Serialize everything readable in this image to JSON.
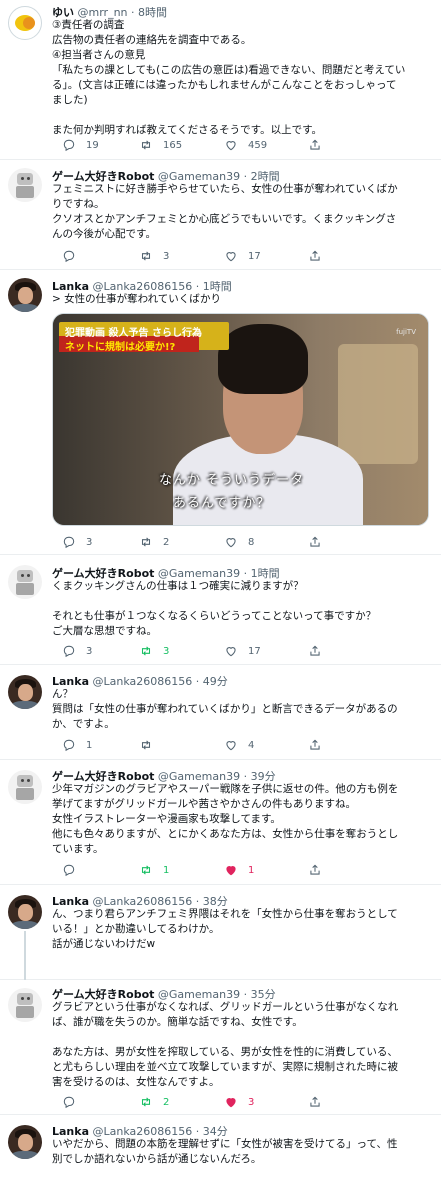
{
  "tweets": [
    {
      "name": "ゆい",
      "handle": "@mrr_nn",
      "time": "· 8時間",
      "lines": [
        "③責任者の調査",
        "広告物の責任者の連絡先を調査中である。",
        "④担当者さんの意見",
        "「私たちの課としても(この広告の意匠は)看過できない、問題だと考えてい",
        "る」。(文言は正確には違ったかもしれませんがこんなことをおっしゃって",
        "ました)",
        "",
        "また何か判明すれば教えてくださるそうです。以上です。"
      ],
      "replies": "19",
      "retweets": "165",
      "likes": "459"
    },
    {
      "name": "ゲーム大好きRobot",
      "handle": "@Gameman39",
      "time": "· 2時間",
      "lines": [
        "フェミニストに好き勝手やらせていたら、女性の仕事が奪われていくばか",
        "りですね。",
        "クソオスとかアンチフェミとか心底どうでもいいです。くまクッキングさ",
        "んの今後が心配です。"
      ],
      "replies": "",
      "retweets": "3",
      "likes": "17"
    },
    {
      "name": "Lanka",
      "handle": "@Lanka26086156",
      "time": "· 1時間",
      "lines": [
        "> 女性の仕事が奪われていくばかり"
      ],
      "media": {
        "banner_top": "犯罪動画 殺人予告 さらし行為",
        "banner_bottom": "ネットに規制は必要か!?",
        "subtitle_1": "なんか そういうデータ",
        "subtitle_2": "あるんですか？",
        "watermark": "fujiTV"
      },
      "replies": "3",
      "retweets": "2",
      "likes": "8"
    },
    {
      "name": "ゲーム大好きRobot",
      "handle": "@Gameman39",
      "time": "· 1時間",
      "lines": [
        "くまクッキングさんの仕事は１つ確実に減りますが？",
        "",
        "それとも仕事が１つなくなるくらいどうってことないって事ですか？",
        "ご大層な思想ですね。"
      ],
      "replies": "3",
      "retweets": "3",
      "likes": "17"
    },
    {
      "name": "Lanka",
      "handle": "@Lanka26086156",
      "time": "· 49分",
      "lines": [
        "ん？",
        "質問は「女性の仕事が奪われていくばかり」と断言できるデータがあるの",
        "か、ですよ。"
      ],
      "replies": "1",
      "retweets": "",
      "likes": "4"
    },
    {
      "name": "ゲーム大好きRobot",
      "handle": "@Gameman39",
      "time": "· 39分",
      "lines": [
        "少年マガジンのグラビアやスーパー戦隊を子供に返せの件。他の方も例を",
        "挙げてますがグリッドガールや茜さやかさんの件もありますね。",
        "女性イラストレーターや漫画家も攻撃してます。",
        "他にも色々ありますが、とにかくあなた方は、女性から仕事を奪おうとし",
        "ています。"
      ],
      "replies": "",
      "retweets": "1",
      "likes": "1"
    },
    {
      "name": "Lanka",
      "handle": "@Lanka26086156",
      "time": "· 38分",
      "lines": [
        "ん、つまり君らアンチフェミ界隈はそれを「女性から仕事を奪おうとして",
        "いる！」とか勘違いしてるわけか。",
        "話が通じないわけだw"
      ],
      "replies": "",
      "retweets": "",
      "likes": ""
    },
    {
      "name": "ゲーム大好きRobot",
      "handle": "@Gameman39",
      "time": "· 35分",
      "lines": [
        "グラビアという仕事がなくなれば、グリッドガールという仕事がなくなれ",
        "ば、誰が職を失うのか。簡単な話ですね、女性です。",
        "",
        "あなた方は、男が女性を搾取している、男が女性を性的に消費している、",
        "と尤もらしい理由を並べ立て攻撃していますが、実際に規制された時に被",
        "害を受けるのは、女性なんですよ。"
      ],
      "replies": "",
      "retweets": "2",
      "likes": "3"
    },
    {
      "name": "Lanka",
      "handle": "@Lanka26086156",
      "time": "· 34分",
      "lines": [
        "いやだから、問題の本筋を理解せずに「女性が被害を受けてる」って、性",
        "別でしか語れないから話が通じないんだろ。"
      ],
      "replies": "",
      "retweets": "",
      "likes": ""
    }
  ],
  "colors": {
    "text": "#0f1419",
    "muted": "#536471",
    "retweet_active": "#17bf63",
    "like_active": "#e0245e",
    "divider": "#ebeef0"
  },
  "icons": [
    "reply-icon",
    "retweet-icon",
    "like-icon",
    "share-icon"
  ]
}
